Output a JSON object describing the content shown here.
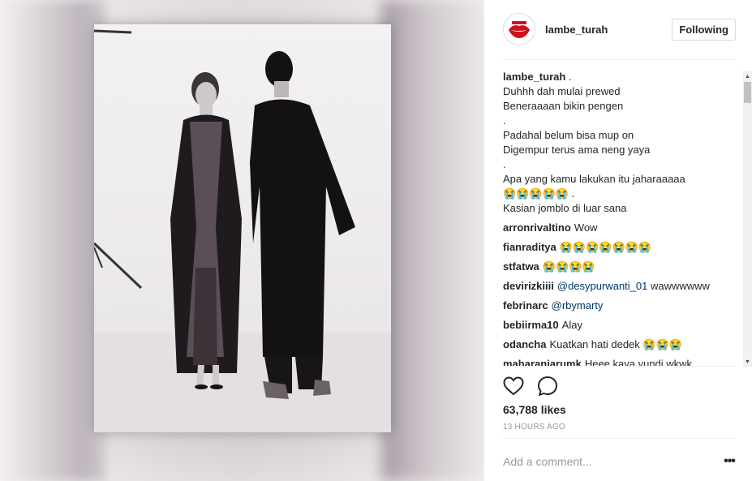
{
  "post": {
    "username": "lambe_turah",
    "follow_label": "Following",
    "caption_user": "lambe_turah",
    "caption_suffix": " .",
    "caption_lines": [
      "Duhhh dah mulai prewed",
      "Beneraaaan bikin pengen",
      ".",
      "Padahal belum bisa mup on",
      "Digempur terus ama neng yaya",
      ".",
      "Apa yang kamu lakukan itu jaharaaaaa",
      "😭😭😭😭😭 .",
      "Kasian jomblo di luar sana"
    ],
    "comments": [
      {
        "user": "arronrivaltino",
        "text": "Wow"
      },
      {
        "user": "fianraditya",
        "text": "😭😭😭😭😭😭😭"
      },
      {
        "user": "stfatwa",
        "text": "😭😭😭😭"
      },
      {
        "user": "devirizkiiii",
        "mention": "@desypurwanti_01",
        "text": " wawwwwww"
      },
      {
        "user": "febrinarc",
        "mention": "@rbymarty",
        "text": ""
      },
      {
        "user": "bebiirma10",
        "text": "Alay"
      },
      {
        "user": "odancha",
        "text": "Kuatkan hati dedek 😭😭😭"
      },
      {
        "user": "maharaniarumk",
        "text": "Heee kaya yundi wkwk"
      }
    ],
    "likes": "63,788 likes",
    "timestamp": "13 HOURS AGO",
    "comment_placeholder": "Add a comment...",
    "more_label": "•••"
  },
  "icons": {
    "avatar": "lips-logo-icon",
    "like": "heart-icon",
    "comment": "comment-bubble-icon",
    "scroll_up": "scroll-up-arrow-icon",
    "scroll_down": "scroll-down-arrow-icon"
  },
  "colors": {
    "mention": "#003569",
    "secondary_text": "#999999",
    "logo_red": "#d0111b"
  }
}
